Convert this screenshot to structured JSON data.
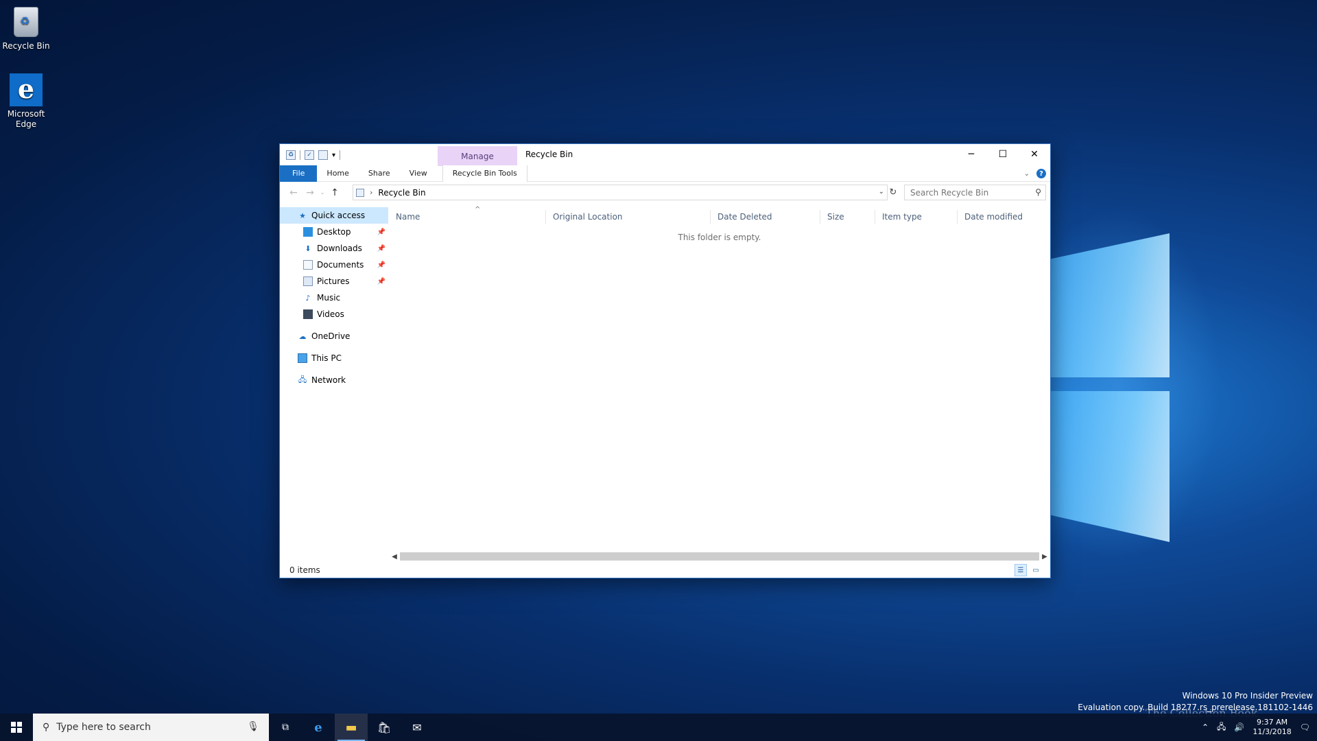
{
  "desktop": {
    "icons": [
      {
        "label": "Recycle Bin"
      },
      {
        "label": "Microsoft Edge"
      }
    ]
  },
  "explorer": {
    "title": "Recycle Bin",
    "contextual_tab": "Manage",
    "ribbon_tabs": {
      "file": "File",
      "home": "Home",
      "share": "Share",
      "view": "View",
      "tools": "Recycle Bin Tools"
    },
    "address": {
      "path": "Recycle Bin"
    },
    "search": {
      "placeholder": "Search Recycle Bin"
    },
    "nav_pane": {
      "quick_access": "Quick access",
      "desktop": "Desktop",
      "downloads": "Downloads",
      "documents": "Documents",
      "pictures": "Pictures",
      "music": "Music",
      "videos": "Videos",
      "onedrive": "OneDrive",
      "this_pc": "This PC",
      "network": "Network"
    },
    "columns": {
      "name": "Name",
      "original_location": "Original Location",
      "date_deleted": "Date Deleted",
      "size": "Size",
      "item_type": "Item type",
      "date_modified": "Date modified"
    },
    "empty_message": "This folder is empty.",
    "status": "0 items"
  },
  "taskbar": {
    "search_placeholder": "Type here to search",
    "time": "9:37 AM",
    "date": "11/3/2018"
  },
  "watermark": {
    "line1": "Windows 10 Pro Insider Preview",
    "line2": "Evaluation copy. Build 18277.rs_prerelease.181102-1446"
  },
  "overlay_text": "The Collection Book",
  "colors": {
    "accent": "#1a6fc4",
    "manage_tab": "#e9d3f7",
    "selection": "#cce8ff"
  }
}
